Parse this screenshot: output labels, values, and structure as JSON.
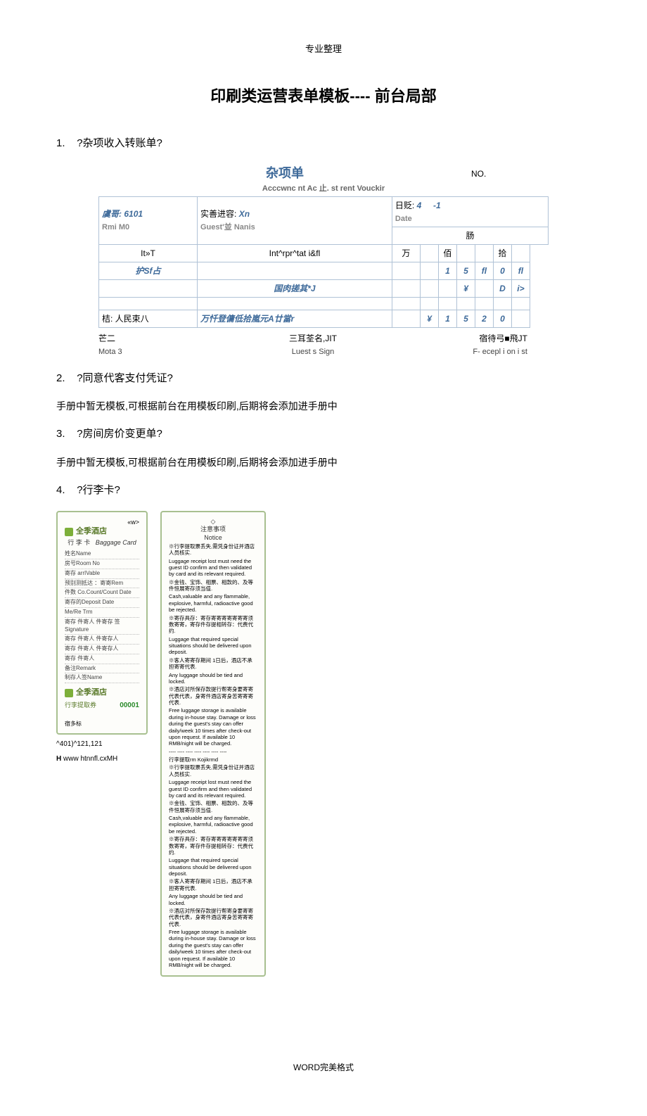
{
  "header_small": "专业整理",
  "title": "印刷类运营表单模板---- 前台局部",
  "items": {
    "n1": "1.",
    "q1": "?杂项收入转账单?",
    "n2": "2.",
    "q2": "?同意代客支付凭证?",
    "n3": "3.",
    "q3": "?房间房价变更单?",
    "n4": "4.",
    "q4": "?行李卡?"
  },
  "body": {
    "template_note": "手册中暂无模板,可根据前台在用模板印刷,后期将会添加进手册中"
  },
  "voucher": {
    "title": "杂项单",
    "sub": "Acccwnc nt Ac 止. st rent Vouckir",
    "no_label": "NO.",
    "room_label_cn": "虞哥:",
    "room_val": "6101",
    "room_label_en": "Rmi M0",
    "guest_label_cn": "实善进容:",
    "guest_val": "Xn",
    "guest_label_en": "Guest'並 Nanis",
    "date_label_cn": "日贬:",
    "date_val1": "4",
    "date_val2": "-1",
    "date_label_en": "Date",
    "col_item": "It»T",
    "col_interp": "Int^rpr^tat i&fl",
    "hdr_sum": "肠",
    "sub_wan": "万",
    "sub_bai": "佰",
    "sub_shi": "拾",
    "r1_item": "护Sf占",
    "r1_c1": "1",
    "r1_c2": "5",
    "r1_c3": "fl",
    "r1_c4": "0",
    "r1_c5": "fl",
    "r2_desc": "国肉搓其*J",
    "r2_c1": "¥",
    "r2_c2": "D",
    "r2_c3": "i>",
    "total_label": "桔:  人民束八",
    "total_val": "万忏登傭低拾嵐元A廿當r",
    "tot_c0": "¥",
    "tot_c1": "1",
    "tot_c2": "5",
    "tot_c3": "2",
    "tot_c4": "0",
    "sig_left_cn": "芒二",
    "sig_mid_cn": "三耳荃名,JIT",
    "sig_right_cn": "宿待弓■飛JT",
    "sig_left_en": "Mota 3",
    "sig_mid_en": "Luest s Sign",
    "sig_right_en": "F- ecepl i on i st"
  },
  "card_left": {
    "w": "«w>",
    "brand": "全季酒店",
    "title_cn": "行 李 卡",
    "title_en": "Baggage Card",
    "rows": [
      "姓名Name",
      "房号Room No",
      "寄存 arrIVable",
      "预别测抵达 ：寄寄Rem",
      "件数 Co.Count/Count Date",
      "寄存的Deposit Date",
      "Me/Re Trm",
      "寄存 件寄人 件寄存 签Signature",
      "寄存 件寄人 件寄存人",
      "寄存 件寄人 件寄存人",
      "寄存 件寄人",
      "备注Remark",
      "制存人签Name"
    ],
    "slip_brand": "全季酒店",
    "slip_title": "行李提取券",
    "slip_amt": "00001",
    "slip_note": "宿多标"
  },
  "card_right": {
    "title_cn": "注意事项",
    "title_en": "Notice",
    "lines": [
      "※行李提取票丢失,需凭身份证并酒店人员核实.",
      "Luggage receipt lost must need the guest ID confirm and then validated by card and its relevant required.",
      "※金钱、宝饰、相票、相款的、及等件恒展寄存须当值.",
      "Cash,valuable and any flammable, explosive, harmful, radioactive good be rejected.",
      "※寄存具存：寄存寄寄寄寄寄寄寄须数寄寄，寄存件存提相转存：代费代约.",
      "Luggage that required special situations should be delivered upon deposit.",
      "※客人寄寄存期间 1日后，酒店不承担寄寄代表.",
      "Any luggage should be tied and locked.",
      "※酒店对所保存款提行帮寄身要寄寄代表代表，身寄件酒店寄身苦寄寄寄代表.",
      "Free luggage storage is available during in-house stay. Damage or loss during the guest's stay can offer daily/week 10 times after check-out upon request. If available 10 RMB/night will be charged.",
      "---- ---- ---- ---- ---- ---- ----",
      "行李提取rm Kojikrmd",
      "※行李提取票丢失,需凭身份证并酒店人员核实.",
      "Luggage receipt lost must need the guest ID confirm and then validated by card and its relevant required.",
      "※金钱、宝饰、相票、相款的、及等件恒展寄存须当值.",
      "Cash,valuable and any flammable, explosive, harmful, radioactive good be rejected.",
      "※寄存具存：寄存寄寄寄寄寄寄寄须数寄寄，寄存件存提相转存：代费代约.",
      "Luggage that required special situations should be delivered upon deposit.",
      "※客人寄寄存期间 1日后，酒店不承担寄寄代表.",
      "Any luggage should be tied and locked.",
      "※酒店对所保存款提行帮寄身要寄寄代表代表，身寄件酒店寄身苦寄寄寄代表.",
      "Free luggage storage is available during in-house stay. Damage or loss during the guest's stay can offer daily/week 10 times after check-out upon request. If available 10 RMB/night will be charged."
    ]
  },
  "url": {
    "line1": "^401)^121,121",
    "line2_bold": "H",
    "line2_rest": " www htnnfl.cxMH"
  },
  "footer": "WORD完美格式"
}
